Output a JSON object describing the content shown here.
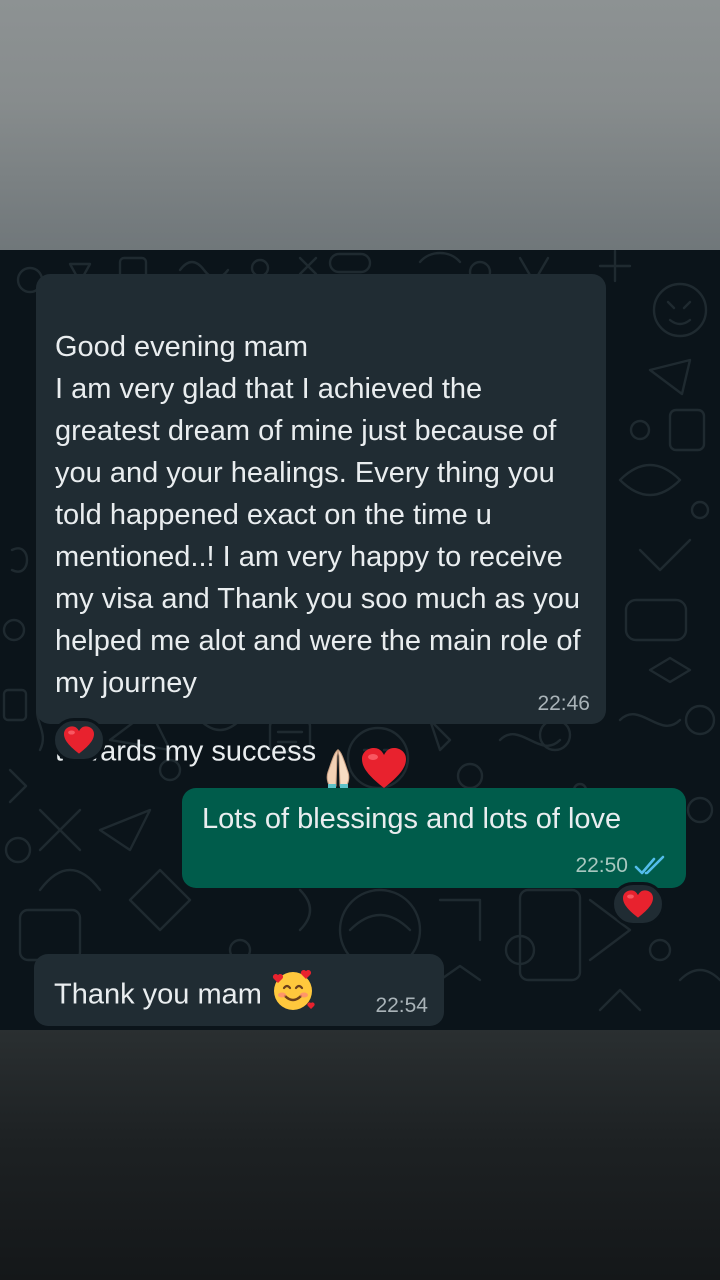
{
  "messages": [
    {
      "direction": "incoming",
      "text": "Good evening mam\nI am very glad that I achieved the greatest dream of mine just because of you and your healings. Every thing you told happened exact on the time u mentioned..!  I am very happy to receive my visa and Thank you soo much as you helped me alot and were the main role of my journey\ntowards my success",
      "time": "22:46",
      "reaction": "red-heart"
    },
    {
      "direction": "outgoing",
      "text": "Lots of blessings and lots of love",
      "time": "22:50",
      "status": "read",
      "reaction": "red-heart"
    },
    {
      "direction": "incoming",
      "text": "Thank you mam",
      "time": "22:54"
    }
  ],
  "colors": {
    "incoming_bubble": "#202c33",
    "outgoing_bubble": "#005c4b",
    "chat_background": "#0b141a",
    "read_ticks": "#53bdeb"
  }
}
